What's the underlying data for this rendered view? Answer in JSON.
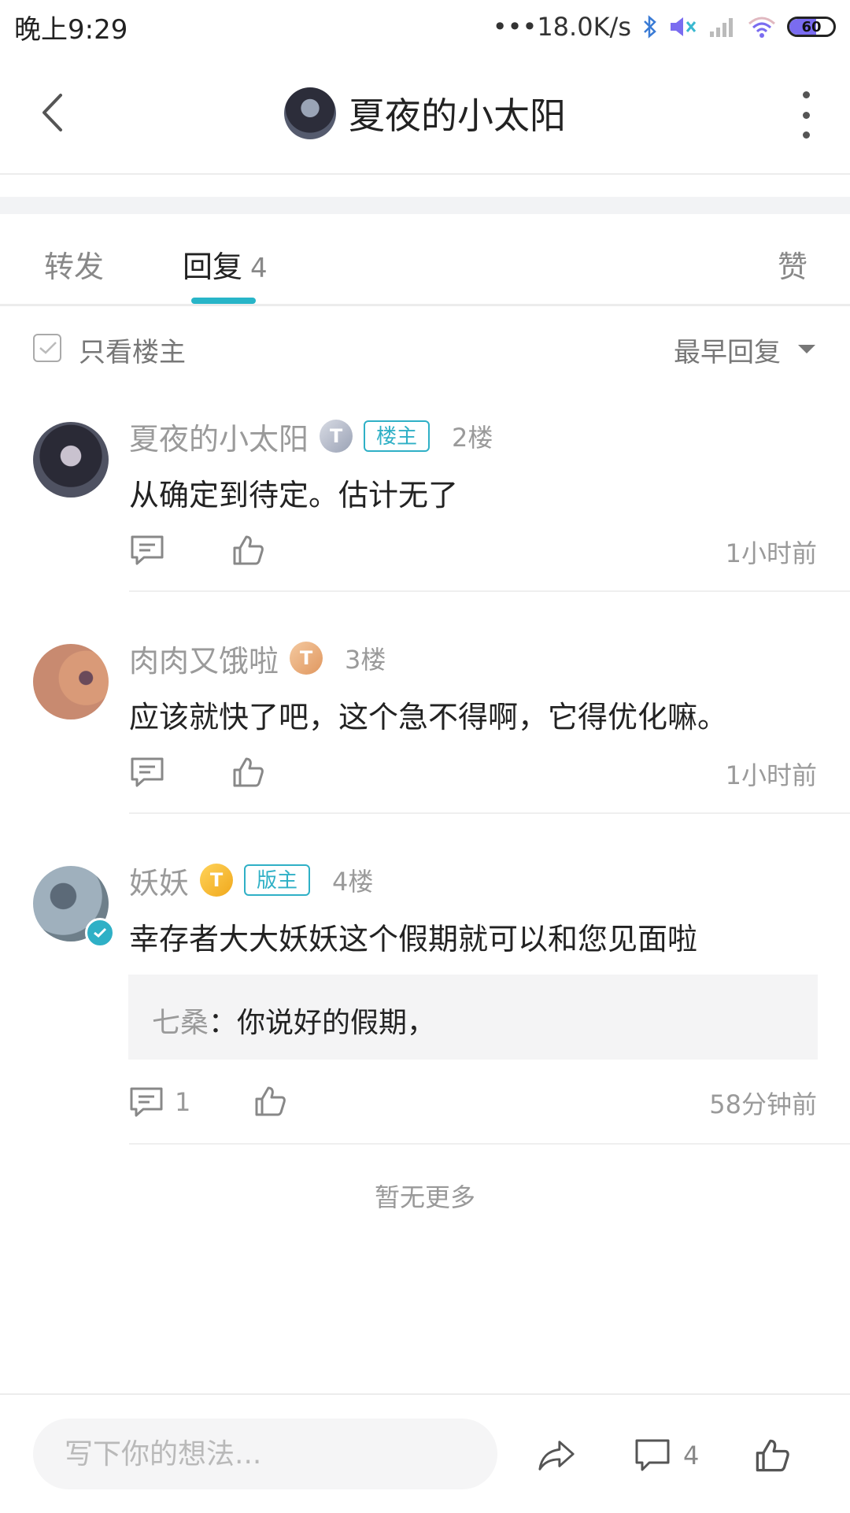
{
  "status_bar": {
    "time": "晚上9:29",
    "network_speed": "•••18.0K/s",
    "battery": "60",
    "icons": [
      "bluetooth-icon",
      "mute-icon",
      "signal-icon",
      "wifi-icon",
      "battery-icon"
    ]
  },
  "header": {
    "title": "夏夜的小太阳"
  },
  "tabs": [
    {
      "label": "转发"
    },
    {
      "label": "回复",
      "count": "4"
    },
    {
      "label": "赞"
    }
  ],
  "filter": {
    "only_op_label": "只看楼主",
    "sort_label": "最早回复"
  },
  "comments": [
    {
      "username": "夏夜的小太阳",
      "level": "T",
      "tag": "楼主",
      "floor": "2楼",
      "text": "从确定到待定。估计无了",
      "time": "1小时前"
    },
    {
      "username": "肉肉又饿啦",
      "level": "T",
      "floor": "3楼",
      "text": "应该就快了吧，这个急不得啊，它得优化嘛。",
      "time": "1小时前"
    },
    {
      "username": "妖妖",
      "level": "T",
      "tag": "版主",
      "floor": "4楼",
      "text": "幸存者大大妖妖这个假期就可以和您见面啦",
      "quote_author": "七桑",
      "quote_sep": "：",
      "quote_text": "你说好的假期，",
      "reply_count": "1",
      "time": "58分钟前"
    }
  ],
  "no_more": "暂无更多",
  "bottom_bar": {
    "input_placeholder": "写下你的想法...",
    "comment_count": "4"
  },
  "colors": {
    "accent": "#28b5c8",
    "tag": "#2fb0c6",
    "text_primary": "#222222",
    "text_secondary": "#9a9a9a"
  }
}
